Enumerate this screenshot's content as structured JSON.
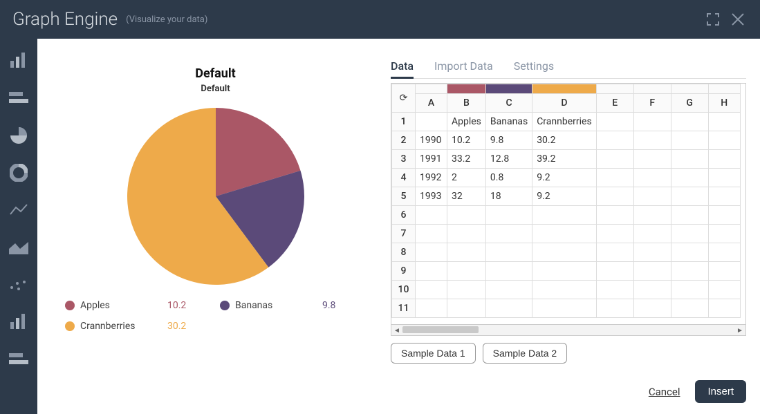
{
  "header": {
    "title": "Graph Engine",
    "subtitle": "(Visualize your data)"
  },
  "sidebar": {
    "icons": [
      "bar-chart",
      "stacked-bar",
      "pie",
      "donut",
      "line",
      "area",
      "scatter",
      "bar-chart-2",
      "stacked-bar-2"
    ],
    "active_index": 2
  },
  "chart": {
    "title": "Default",
    "subtitle": "Default"
  },
  "legend": [
    {
      "name": "Apples",
      "value": "10.2",
      "color": "#aa5766"
    },
    {
      "name": "Bananas",
      "value": "9.8",
      "color": "#5b4a79"
    },
    {
      "name": "Crannberries",
      "value": "30.2",
      "color": "#eeaa4a"
    }
  ],
  "tabs": {
    "items": [
      "Data",
      "Import Data",
      "Settings"
    ],
    "active": 0
  },
  "sheet": {
    "columns": [
      "A",
      "B",
      "C",
      "D",
      "E",
      "F",
      "G",
      "H"
    ],
    "color_fills": {
      "B": "#aa5766",
      "C": "#5b4a79",
      "D": "#eeaa4a"
    },
    "rows": [
      {
        "n": 1,
        "cells": [
          "",
          "Apples",
          "Bananas",
          "Crannberries",
          "",
          "",
          "",
          ""
        ]
      },
      {
        "n": 2,
        "cells": [
          "1990",
          "10.2",
          "9.8",
          "30.2",
          "",
          "",
          "",
          ""
        ]
      },
      {
        "n": 3,
        "cells": [
          "1991",
          "33.2",
          "12.8",
          "39.2",
          "",
          "",
          "",
          ""
        ]
      },
      {
        "n": 4,
        "cells": [
          "1992",
          "2",
          "0.8",
          "9.2",
          "",
          "",
          "",
          ""
        ]
      },
      {
        "n": 5,
        "cells": [
          "1993",
          "32",
          "18",
          "9.2",
          "",
          "",
          "",
          ""
        ]
      },
      {
        "n": 6,
        "cells": [
          "",
          "",
          "",
          "",
          "",
          "",
          "",
          ""
        ]
      },
      {
        "n": 7,
        "cells": [
          "",
          "",
          "",
          "",
          "",
          "",
          "",
          ""
        ]
      },
      {
        "n": 8,
        "cells": [
          "",
          "",
          "",
          "",
          "",
          "",
          "",
          ""
        ]
      },
      {
        "n": 9,
        "cells": [
          "",
          "",
          "",
          "",
          "",
          "",
          "",
          ""
        ]
      },
      {
        "n": 10,
        "cells": [
          "",
          "",
          "",
          "",
          "",
          "",
          "",
          ""
        ]
      },
      {
        "n": 11,
        "cells": [
          "",
          "",
          "",
          "",
          "",
          "",
          "",
          ""
        ]
      }
    ],
    "col_widths": {
      "A": 46,
      "B": 54,
      "C": 64,
      "D": 92,
      "E": 54,
      "F": 54,
      "G": 54,
      "H": 46
    }
  },
  "sample_buttons": [
    "Sample Data 1",
    "Sample Data 2"
  ],
  "footer": {
    "cancel": "Cancel",
    "insert": "Insert"
  },
  "chart_data": {
    "type": "pie",
    "title": "Default",
    "subtitle": "Default",
    "categories": [
      "Apples",
      "Bananas",
      "Crannberries"
    ],
    "values": [
      10.2,
      9.8,
      30.2
    ],
    "colors": [
      "#aa5766",
      "#5b4a79",
      "#eeaa4a"
    ]
  }
}
